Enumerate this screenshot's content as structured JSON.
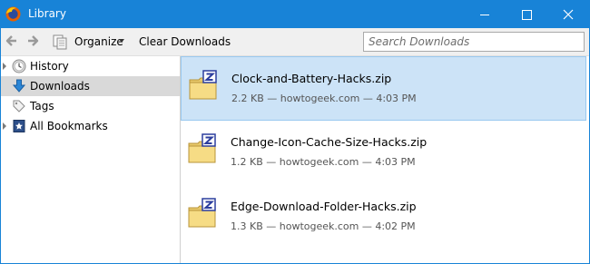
{
  "window": {
    "title": "Library",
    "app_icon": "firefox-icon",
    "controls": [
      "minimize-icon",
      "maximize-icon",
      "close-icon"
    ]
  },
  "toolbar": {
    "back_icon": "back-arrow-icon",
    "forward_icon": "forward-arrow-icon",
    "organize_label": "Organize",
    "organize_icon": "organize-icon",
    "clear_label": "Clear Downloads",
    "search_placeholder": "Search Downloads",
    "search_value": ""
  },
  "sidebar": {
    "items": [
      {
        "label": "History",
        "icon": "clock-icon",
        "expandable": true,
        "selected": false
      },
      {
        "label": "Downloads",
        "icon": "download-arrow-icon",
        "expandable": false,
        "selected": true
      },
      {
        "label": "Tags",
        "icon": "tag-icon",
        "expandable": false,
        "selected": false
      },
      {
        "label": "All Bookmarks",
        "icon": "bookmarks-icon",
        "expandable": true,
        "selected": false
      }
    ]
  },
  "downloads": [
    {
      "name": "Clock-and-Battery-Hacks.zip",
      "meta": "2.2 KB — howtogeek.com — 4:03 PM",
      "selected": true,
      "icon": "zip-folder-icon"
    },
    {
      "name": "Change-Icon-Cache-Size-Hacks.zip",
      "meta": "1.2 KB — howtogeek.com — 4:03 PM",
      "selected": false,
      "icon": "zip-folder-icon"
    },
    {
      "name": "Edge-Download-Folder-Hacks.zip",
      "meta": "1.3 KB — howtogeek.com — 4:02 PM",
      "selected": false,
      "icon": "zip-folder-icon"
    }
  ],
  "colors": {
    "titlebar": "#1883d7",
    "selection": "#cce3f7",
    "selection_border": "#99c9ef",
    "sidebar_selection": "#d9d9d9"
  }
}
